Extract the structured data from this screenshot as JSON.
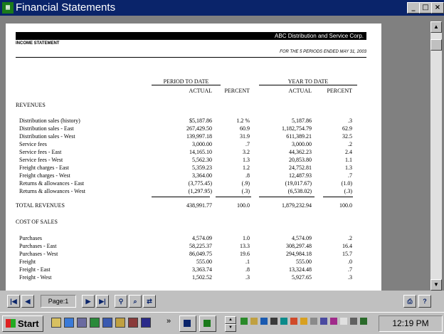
{
  "window": {
    "title": "Financial Statements",
    "icon": "spreadsheet-icon",
    "minimize": "_",
    "maximize": "□",
    "close": "×"
  },
  "report": {
    "company": "ABC Distribution and Service Corp.",
    "statement": "INCOME STATEMENT",
    "period": "FOR THE 5 PERIODS ENDED MAY 31, 2003",
    "group_ptd": "PERIOD TO DATE",
    "group_ytd": "YEAR TO DATE",
    "col_actual": "ACTUAL",
    "col_percent": "PERCENT",
    "sections": {
      "revenues": "REVENUES",
      "cost_of_sales": "COST OF SALES",
      "total_revenues": {
        "label": "TOTAL REVENUES",
        "ptd_actual": "438,991.77",
        "ptd_percent": "100.0",
        "ytd_actual": "1,879,232.94",
        "ytd_percent": "100.0"
      }
    },
    "revenue_rows": [
      {
        "label": "Distribution sales (history)",
        "ptd_actual": "$5,187.86",
        "ptd_percent": "1.2 %",
        "ytd_actual": "5,187.86",
        "ytd_percent": ".3"
      },
      {
        "label": "Distribution sales - East",
        "ptd_actual": "267,429.50",
        "ptd_percent": "60.9",
        "ytd_actual": "1,182,754.79",
        "ytd_percent": "62.9"
      },
      {
        "label": "Distribution sales - West",
        "ptd_actual": "139,997.18",
        "ptd_percent": "31.9",
        "ytd_actual": "611,389.21",
        "ytd_percent": "32.5"
      },
      {
        "label": "Service fees",
        "ptd_actual": "3,000.00",
        "ptd_percent": ".7",
        "ytd_actual": "3,000.00",
        "ytd_percent": ".2"
      },
      {
        "label": "Service fees - East",
        "ptd_actual": "14,165.10",
        "ptd_percent": "3.2",
        "ytd_actual": "44,362.23",
        "ytd_percent": "2.4"
      },
      {
        "label": "Service fees - West",
        "ptd_actual": "5,562.30",
        "ptd_percent": "1.3",
        "ytd_actual": "20,853.80",
        "ytd_percent": "1.1"
      },
      {
        "label": "Freight charges - East",
        "ptd_actual": "5,359.23",
        "ptd_percent": "1.2",
        "ytd_actual": "24,752.81",
        "ytd_percent": "1.3"
      },
      {
        "label": "Freight charges - West",
        "ptd_actual": "3,364.00",
        "ptd_percent": ".8",
        "ytd_actual": "12,487.93",
        "ytd_percent": ".7"
      },
      {
        "label": "Returns & allowances - East",
        "ptd_actual": "(3,775.45)",
        "ptd_percent": "(.9)",
        "ytd_actual": "(19,017.67)",
        "ytd_percent": "(1.0)"
      },
      {
        "label": "Returns & allowances - West",
        "ptd_actual": "(1,297.95)",
        "ptd_percent": "(.3)",
        "ytd_actual": "(6,538.02)",
        "ytd_percent": "(.3)"
      }
    ],
    "cost_rows": [
      {
        "label": "Purchases",
        "ptd_actual": "4,574.09",
        "ptd_percent": "1.0",
        "ytd_actual": "4,574.09",
        "ytd_percent": ".2"
      },
      {
        "label": "Purchases - East",
        "ptd_actual": "58,225.37",
        "ptd_percent": "13.3",
        "ytd_actual": "308,297.48",
        "ytd_percent": "16.4"
      },
      {
        "label": "Purchases - West",
        "ptd_actual": "86,049.75",
        "ptd_percent": "19.6",
        "ytd_actual": "294,984.18",
        "ytd_percent": "15.7"
      },
      {
        "label": "Freight",
        "ptd_actual": "555.00",
        "ptd_percent": ".1",
        "ytd_actual": "555.00",
        "ytd_percent": ".0"
      },
      {
        "label": "Freight - East",
        "ptd_actual": "3,363.74",
        "ptd_percent": ".8",
        "ytd_actual": "13,324.48",
        "ytd_percent": ".7"
      },
      {
        "label": "Freight - West",
        "ptd_actual": "1,502.52",
        "ptd_percent": ".3",
        "ytd_actual": "5,927.65",
        "ytd_percent": ".3"
      }
    ]
  },
  "toolbar": {
    "page_label": "Page:1",
    "first": "|◀",
    "prev": "◀",
    "next": "▶",
    "last": "▶|"
  },
  "taskbar": {
    "start": "Start",
    "clock": "12:19 PM",
    "chevron": "»"
  }
}
